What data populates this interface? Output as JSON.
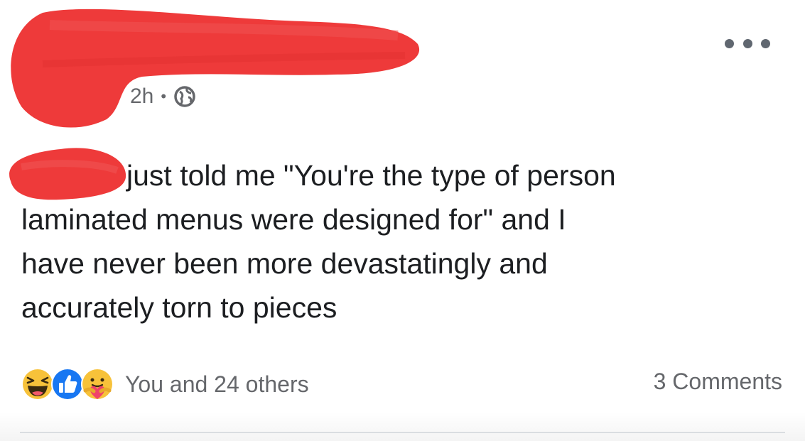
{
  "post": {
    "timestamp": "2h",
    "separator": "•",
    "privacy_icon": "globe-icon",
    "more_icon": "more-options-icon",
    "text_line1": "just told me \"You're the type of person",
    "text_line2": "laminated menus were designed for\" and I",
    "text_line3": "have never been more devastatingly and",
    "text_line4": "accurately torn to pieces"
  },
  "reactions": {
    "icons": [
      "haha-reaction-icon",
      "like-reaction-icon",
      "care-reaction-icon"
    ],
    "summary": "You and 24 others",
    "comments": "3 Comments"
  },
  "colors": {
    "redaction": "#ee3a3a",
    "secondary_text": "#65676b",
    "like_blue": "#1877f2",
    "reaction_yellow": "#f7c23a"
  }
}
